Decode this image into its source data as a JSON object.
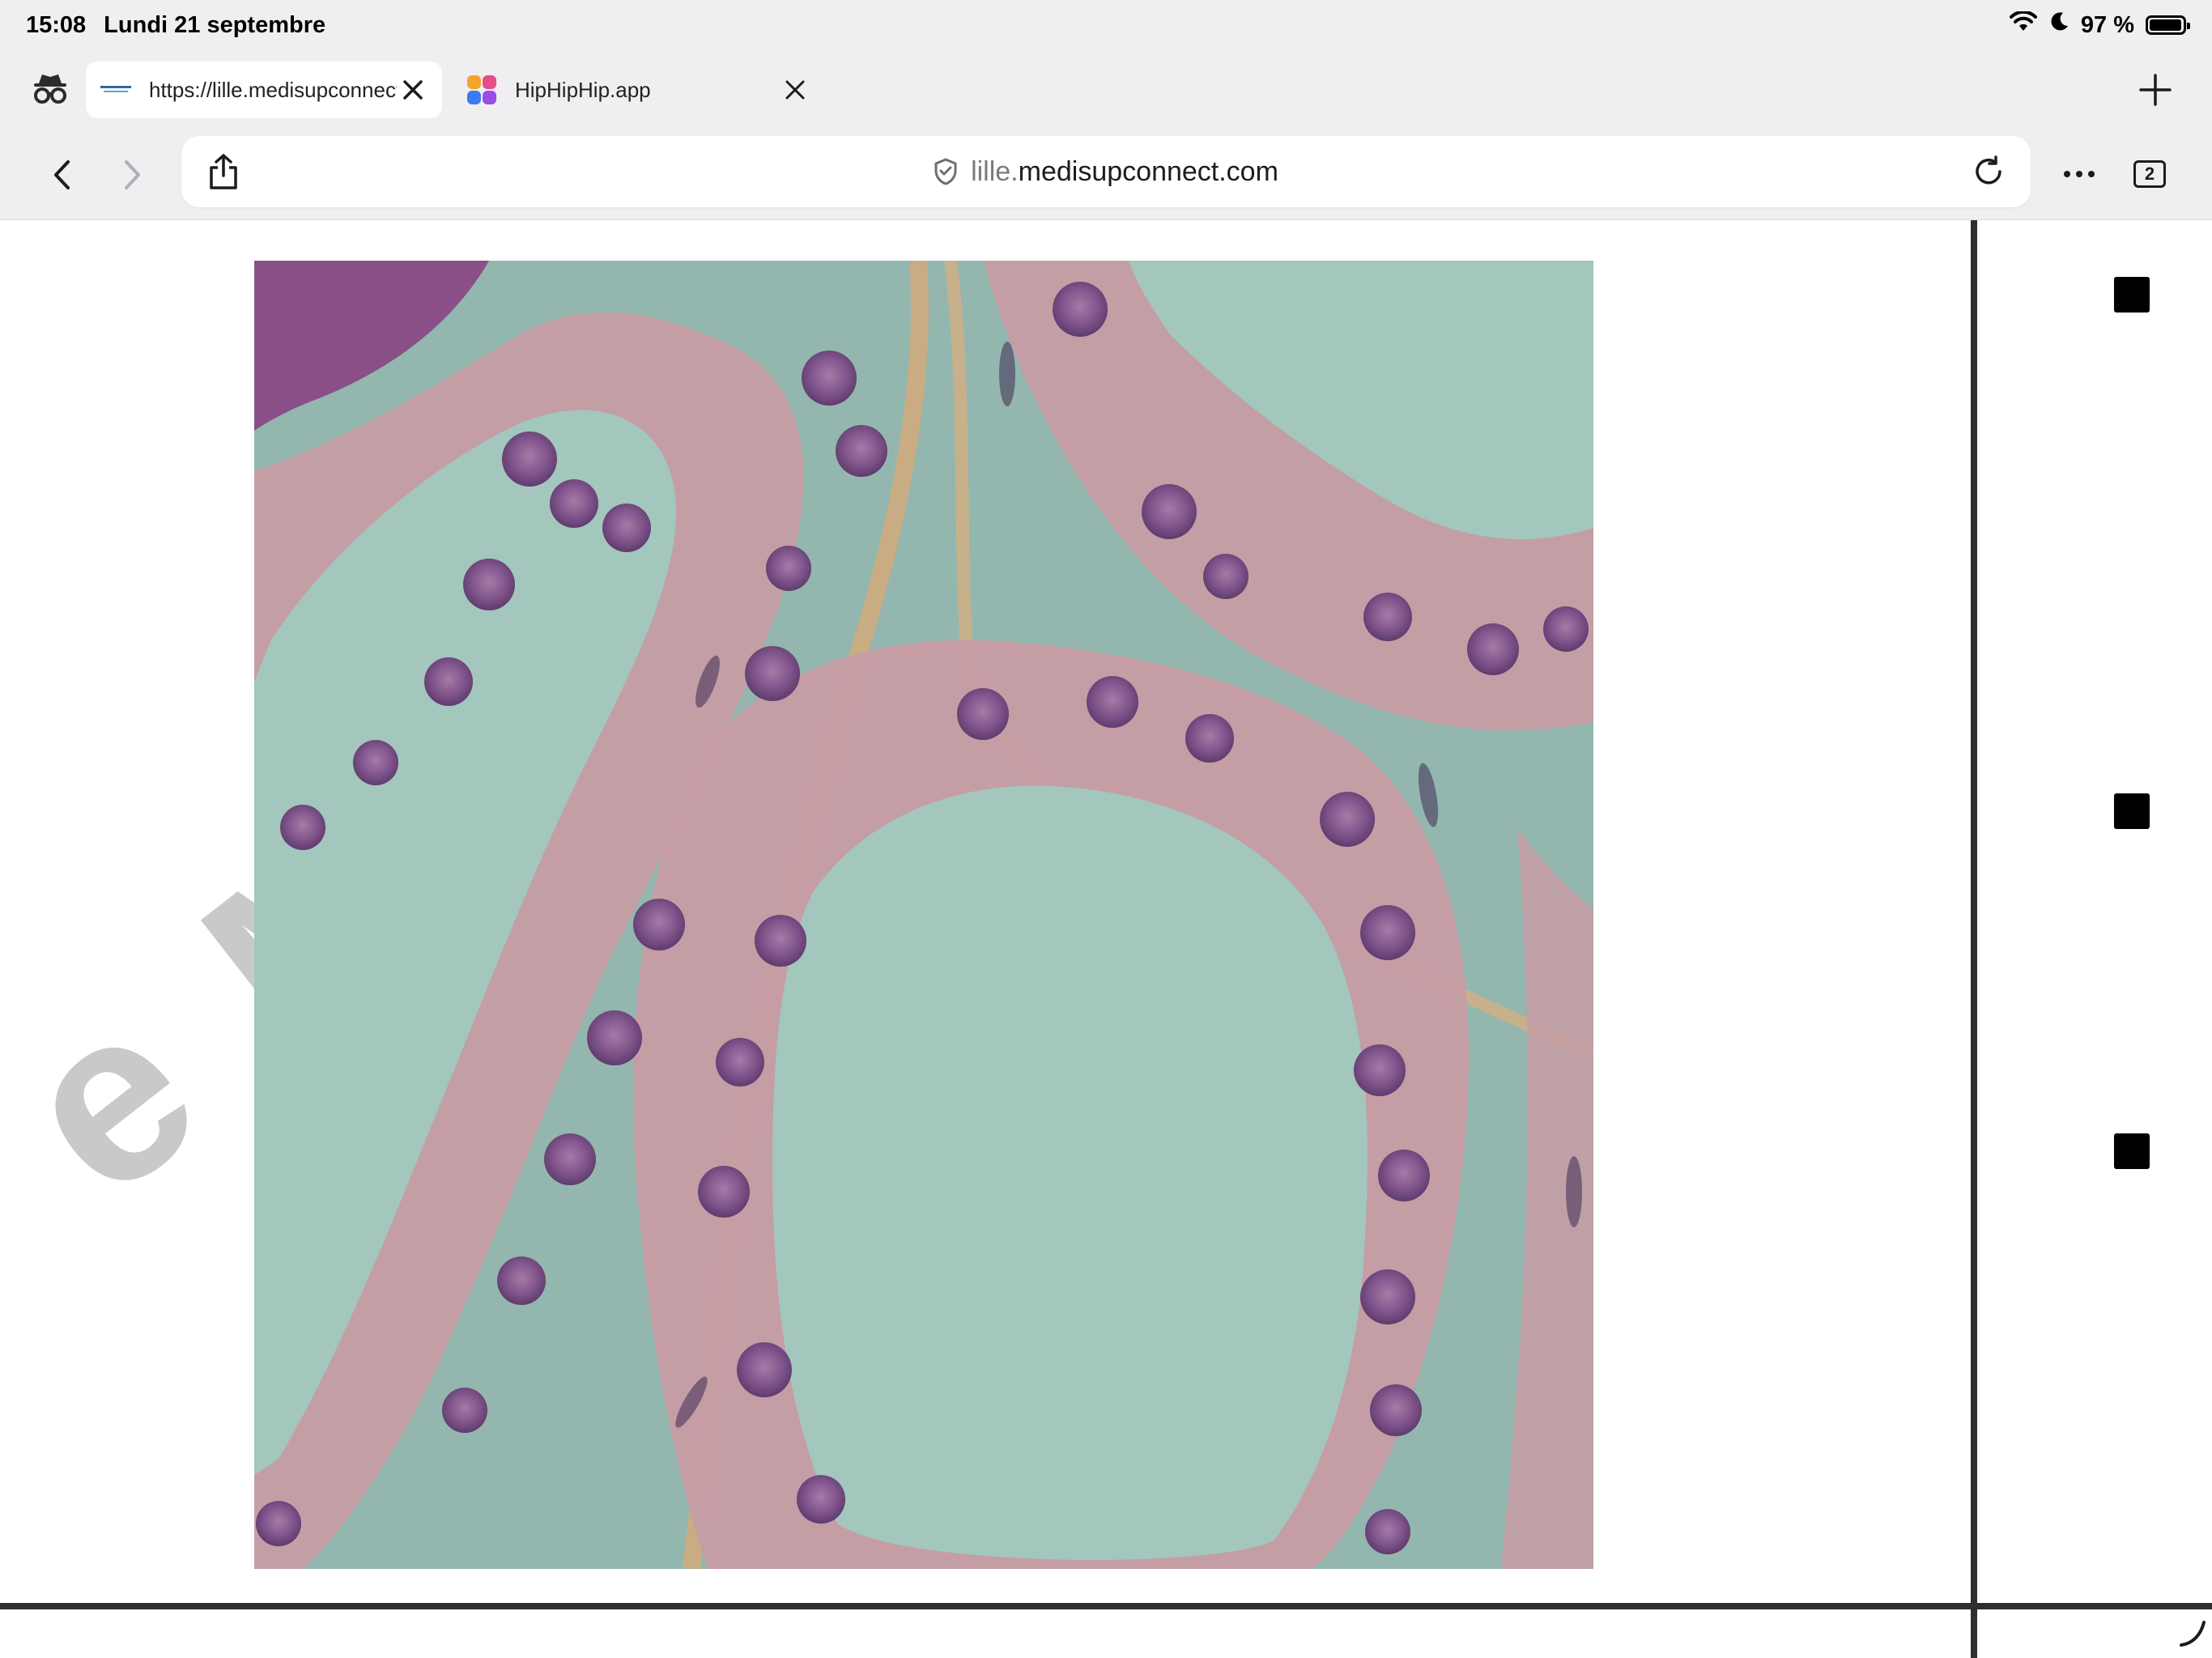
{
  "status_bar": {
    "time": "15:08",
    "date": "Lundi 21 septembre",
    "battery": "97 %",
    "icons": [
      "wifi-icon",
      "moon-icon",
      "battery-icon"
    ]
  },
  "tabs": [
    {
      "title": "https://lille.medisupconnect.com",
      "active": true,
      "favicon": "medisup-favicon"
    },
    {
      "title": "HipHipHip.app",
      "active": false,
      "favicon": "hiphiphip-favicon"
    }
  ],
  "address_bar": {
    "subdomain": "lille.",
    "domain": "medisupconnect.com"
  },
  "tab_count": "2",
  "colors": {
    "chrome": "#efeff1",
    "tissue_bg": "#93b7ae",
    "cell_pink": "#c79aa6",
    "nucleus": "#7a4d86"
  }
}
